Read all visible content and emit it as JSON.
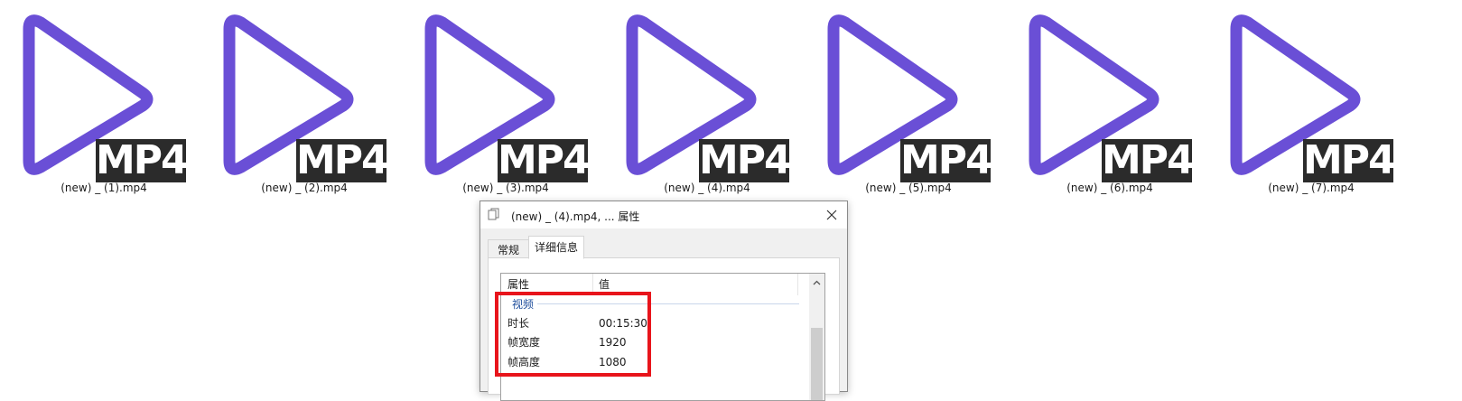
{
  "files": [
    {
      "name": "(new)  _ (1).mp4",
      "badge": "MP4"
    },
    {
      "name": "(new)  _ (2).mp4",
      "badge": "MP4"
    },
    {
      "name": "(new)  _ (3).mp4",
      "badge": "MP4"
    },
    {
      "name": "(new)  _ (4).mp4",
      "badge": "MP4"
    },
    {
      "name": "(new)  _ (5).mp4",
      "badge": "MP4"
    },
    {
      "name": "(new)  _ (6).mp4",
      "badge": "MP4"
    },
    {
      "name": "(new)  _ (7).mp4",
      "badge": "MP4"
    }
  ],
  "colors": {
    "play_icon": "#6a4fd6",
    "badge_bg": "#2b2b2b",
    "highlight": "#e8141b",
    "group_label": "#1f4e9c"
  },
  "dialog": {
    "title": "(new)  _ (4).mp4, ... 属性",
    "close_icon": "close-icon",
    "tabs": {
      "general": "常规",
      "details": "详细信息"
    },
    "columns": {
      "property": "属性",
      "value": "值"
    },
    "group": "视频",
    "rows": [
      {
        "key": "时长",
        "value": "00:15:30"
      },
      {
        "key": "帧宽度",
        "value": "1920"
      },
      {
        "key": "帧高度",
        "value": "1080"
      }
    ]
  }
}
